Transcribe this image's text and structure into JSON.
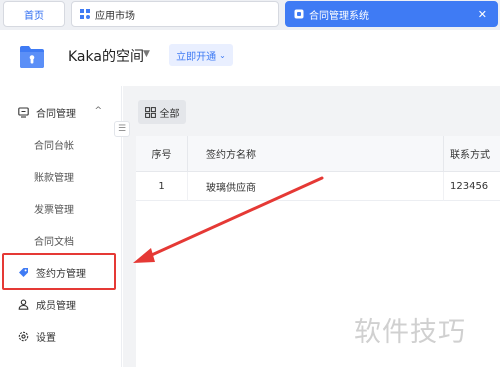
{
  "tabs": [
    {
      "label": "首页"
    },
    {
      "label": "应用市场",
      "icon": "grid-apps-icon"
    },
    {
      "label": "合同管理系统",
      "icon": "app-icon",
      "active": true
    }
  ],
  "header": {
    "space_title": "Kaka的空间",
    "open_button": "立即开通"
  },
  "sidebar": {
    "items": [
      {
        "label": "合同管理",
        "icon": "monitor-icon",
        "expanded": true
      },
      {
        "label": "合同台帐"
      },
      {
        "label": "账款管理"
      },
      {
        "label": "发票管理"
      },
      {
        "label": "合同文档"
      },
      {
        "label": "签约方管理",
        "icon": "tag-icon",
        "active": true
      },
      {
        "label": "成员管理",
        "icon": "user-icon"
      },
      {
        "label": "设置",
        "icon": "gear-icon"
      }
    ]
  },
  "main": {
    "filter_label": "全部",
    "table": {
      "headers": [
        "序号",
        "签约方名称",
        "联系方式"
      ],
      "rows": [
        [
          "1",
          "玻璃供应商",
          "123456"
        ]
      ]
    }
  },
  "watermark": "软件技巧",
  "colors": {
    "accent": "#3f7bf4",
    "highlight": "#e53935"
  }
}
